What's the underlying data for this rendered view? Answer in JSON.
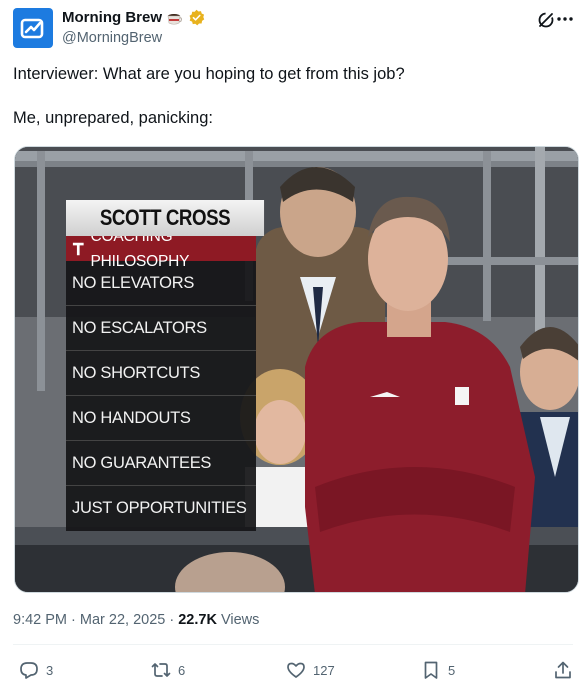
{
  "author": {
    "name": "Morning Brew",
    "handle": "@MorningBrew",
    "icons": [
      "coffee-icon",
      "verified-icon"
    ],
    "brand_color": "#1d7be0",
    "verified_color": "#e8b21e"
  },
  "tweet": {
    "line1": "Interviewer: What are you hoping to get from this job?",
    "line2": "Me, unprepared, panicking:"
  },
  "media": {
    "overlay": {
      "name": "SCOTT CROSS",
      "subtitle": "COACHING PHILOSOPHY",
      "items": [
        "NO ELEVATORS",
        "NO ESCALATORS",
        "NO SHORTCUTS",
        "NO HANDOUTS",
        "NO GUARANTEES",
        "JUST OPPORTUNITIES"
      ],
      "accent": "#8e1a24"
    }
  },
  "meta": {
    "time": "9:42 PM · Mar 22, 2025 · ",
    "views_count": "22.7K",
    "views_label": " Views"
  },
  "actions": {
    "replies": "3",
    "reposts": "6",
    "likes": "127",
    "bookmarks": "5"
  }
}
